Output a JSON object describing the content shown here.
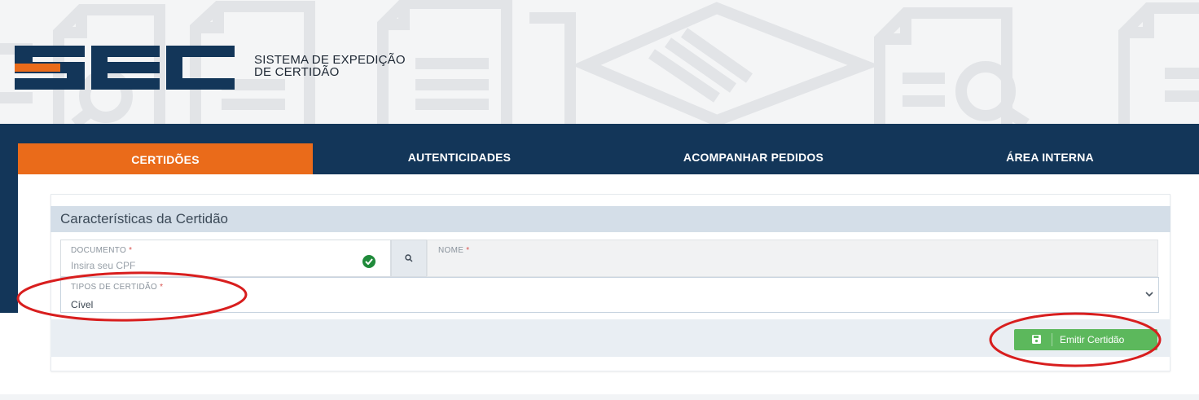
{
  "brand": {
    "logo_letters": "SEC",
    "tagline_line1": "SISTEMA DE EXPEDIÇÃO",
    "tagline_line2": "DE CERTIDÃO",
    "color_navy": "#133659",
    "color_orange": "#ea6b1a"
  },
  "nav": {
    "items": [
      {
        "label": "CERTIDÕES",
        "active": true
      },
      {
        "label": "AUTENTICIDADES",
        "active": false
      },
      {
        "label": "ACOMPANHAR PEDIDOS",
        "active": false
      },
      {
        "label": "ÁREA INTERNA",
        "active": false
      }
    ]
  },
  "form": {
    "title": "Características da Certidão",
    "documento": {
      "label": "DOCUMENTO",
      "required_mark": "*",
      "placeholder": "Insira seu CPF",
      "status_icon": "check-circle-icon"
    },
    "search_icon": "search-icon",
    "nome": {
      "label": "NOME",
      "required_mark": "*"
    },
    "tipos": {
      "label": "TIPOS DE CERTIDÃO",
      "required_mark": "*",
      "value": "Cível",
      "dropdown_icon": "chevron-down-icon"
    },
    "submit": {
      "label": "Emitir Certidão",
      "icon": "save-icon",
      "color": "#5cb85c"
    }
  },
  "annotation_color": "#d81e1e"
}
